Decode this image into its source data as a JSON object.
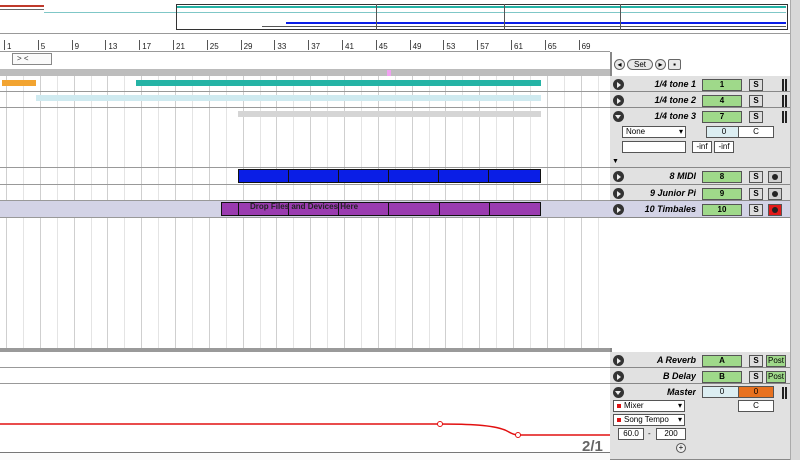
{
  "ruler": {
    "bars": [
      "1",
      "5",
      "9",
      "13",
      "17",
      "21",
      "25",
      "29",
      "33",
      "37",
      "41",
      "45",
      "49",
      "53",
      "57",
      "61",
      "65",
      "69"
    ]
  },
  "loop_brace_label": "> <",
  "set_button": "Set",
  "drop_message": "Drop Files and Devices Here",
  "page_indicator": "2/1",
  "colors": {
    "orange": "#f2a431",
    "teal": "#25b3a5",
    "light_cyan": "#cfeaf0",
    "grey_clip": "#d5d5d5",
    "blue": "#0a1ee6",
    "purple": "#9a3bb0",
    "automation": "#e21010",
    "volume_green": "#9fd98a"
  },
  "tracks": [
    {
      "name": "1/4 tone 1",
      "volume": "1",
      "solo": "S",
      "expanded": false
    },
    {
      "name": "1/4 tone 2",
      "volume": "4",
      "solo": "S",
      "expanded": false
    },
    {
      "name": "1/4 tone 3",
      "volume": "7",
      "solo": "S",
      "expanded": true,
      "device_chooser": "None",
      "value_field": "0",
      "pan_field": "C",
      "min_left": "-inf",
      "min_right": "-inf"
    },
    {
      "name": "8 MIDI",
      "volume": "8",
      "solo": "S",
      "armed": false
    },
    {
      "name": "9 Junior Pi",
      "volume": "9",
      "solo": "S",
      "armed": false
    },
    {
      "name": "10 Timbales",
      "volume": "10",
      "solo": "S",
      "armed": true
    }
  ],
  "returns": [
    {
      "name": "A Reverb",
      "send": "A",
      "solo": "S",
      "post": "Post"
    },
    {
      "name": "B Delay",
      "send": "B",
      "solo": "S",
      "post": "Post"
    }
  ],
  "master": {
    "name": "Master",
    "field_left": "0",
    "field_right": "0",
    "pan": "C",
    "device_chooser": "Mixer",
    "control_chooser": "Song Tempo",
    "range_min": "60.0",
    "range_sep": "-",
    "range_max": "200"
  }
}
